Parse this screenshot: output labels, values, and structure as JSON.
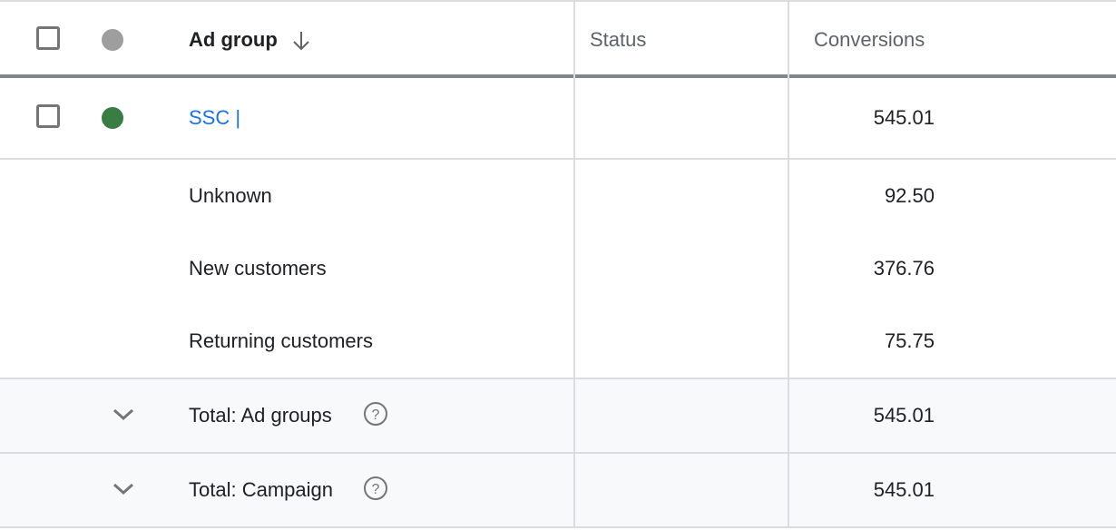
{
  "table": {
    "header": {
      "ad_group_label": "Ad group",
      "sort_icon": "arrow-down-icon",
      "status_label": "Status",
      "conversions_label": "Conversions"
    },
    "colors": {
      "header_status_dot": "#9e9e9e",
      "enabled_status_dot": "#3a7d44",
      "link": "#1a73e8",
      "total_row_bg": "#f8f9fa",
      "header_divider": "#80868b"
    },
    "ad_group_row": {
      "name": "SSC |",
      "status": "",
      "conversions": "545.01",
      "status_dot": "enabled"
    },
    "segments": [
      {
        "label": "Unknown",
        "conversions": "92.50"
      },
      {
        "label": "New customers",
        "conversions": "376.76"
      },
      {
        "label": "Returning customers",
        "conversions": "75.75"
      }
    ],
    "totals": [
      {
        "label": "Total: Ad groups",
        "conversions": "545.01",
        "expand_icon": "chevron-down-icon",
        "help_icon": "help-circle-icon"
      },
      {
        "label": "Total: Campaign",
        "conversions": "545.01",
        "expand_icon": "chevron-down-icon",
        "help_icon": "help-circle-icon"
      }
    ]
  }
}
